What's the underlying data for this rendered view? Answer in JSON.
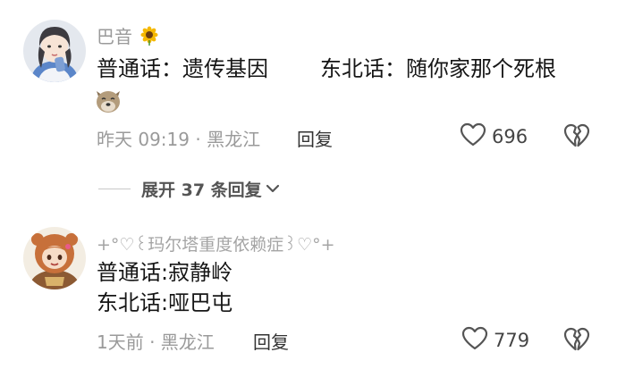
{
  "comments": [
    {
      "username": "巴音",
      "username_emoji": "sunflower",
      "line1_a": "普通话：遗传基因",
      "line1_b": "东北话：随你家那个死根",
      "extra_emoji": "dog-face",
      "time_location": "昨天 09:19 · 黑龙江",
      "reply_label": "回复",
      "likes": "696"
    },
    {
      "username": "+°♡꒰玛尔塔重度依赖症꒱♡°+",
      "line1": "普通话:寂静岭",
      "line2": "东北话:哑巴屯",
      "time_location": "1天前 · 黑龙江",
      "reply_label": "回复",
      "likes": "779"
    }
  ],
  "expand_replies_label": "展开 37 条回复",
  "icons": {
    "like": "heart-outline-icon",
    "dislike": "broken-heart-icon",
    "expand": "chevron-down-icon"
  },
  "colors": {
    "meta": "#9a9a9a",
    "text": "#161616",
    "icon": "#555555"
  }
}
